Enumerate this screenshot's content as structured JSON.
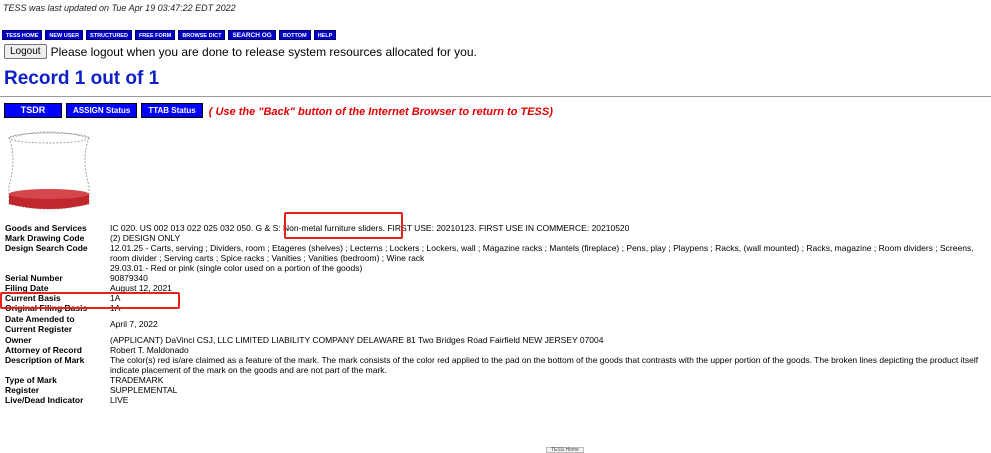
{
  "updated_text": "TESS was last updated on Tue Apr 19 03:47:22 EDT 2022",
  "nav": [
    {
      "label": "TESS Home"
    },
    {
      "label": "New User"
    },
    {
      "label": "Structured"
    },
    {
      "label": "Free Form"
    },
    {
      "label": "Browse Dict"
    },
    {
      "label": "SEARCH OG"
    },
    {
      "label": "Bottom"
    },
    {
      "label": "HELP"
    }
  ],
  "logout": {
    "button_label": "Logout",
    "message": "Please logout when you are done to release system resources allocated for you."
  },
  "record_title": "Record 1 out of 1",
  "status_buttons": {
    "tsdr": "TSDR",
    "assign": "ASSIGN Status",
    "ttab": "TTAB Status"
  },
  "back_message": "( Use the \"Back\" button of the Internet Browser to return to TESS)",
  "mark_image": {
    "icon": "design-mark-image",
    "fill_color": "#c0272d"
  },
  "fields": [
    {
      "label": "Goods and Services",
      "value": "IC 020. US 002 013 022 025 032 050. G & S: Non-metal furniture sliders. FIRST USE: 20210123. FIRST USE IN COMMERCE: 20210520"
    },
    {
      "label": "Mark Drawing Code",
      "value": "(2) DESIGN ONLY"
    },
    {
      "label": "Design Search Code",
      "value": "12.01.25 - Carts, serving ; Dividers, room ; Etageres (shelves) ; Lecterns ; Lockers ; Lockers, wall ; Magazine racks ; Mantels (fireplace) ; Pens, play ; Playpens ; Racks, (wall mounted) ; Racks, magazine ; Room dividers ; Screens, room divider ; Serving carts ; Spice racks ; Vanities ; Vanities (bedroom) ; Wine rack",
      "value2": "29.03.01 - Red or pink (single color used on a portion of the goods)"
    },
    {
      "label": "Serial Number",
      "value": "90879340"
    },
    {
      "label": "Filing Date",
      "value": "August 12, 2021"
    },
    {
      "label": "Current Basis",
      "value": "1A"
    },
    {
      "label": "Original Filing Basis",
      "value": "1A"
    },
    {
      "label": "Date Amended to Current Register",
      "value": "April 7, 2022"
    },
    {
      "label": "Owner",
      "value": "(APPLICANT) DaVinci CSJ, LLC LIMITED LIABILITY COMPANY DELAWARE 81 Two Bridges Road Fairfield NEW JERSEY 07004"
    },
    {
      "label": "Attorney of Record",
      "value": "Robert T. Maldonado"
    },
    {
      "label": "Description of Mark",
      "value": "The color(s) red is/are claimed as a feature of the mark. The mark consists of the color red applied to the pad on the bottom of the goods that contrasts with the upper portion of the goods. The broken lines depicting the product itself indicate placement of the mark on the goods and are not part of the mark."
    },
    {
      "label": "Type of Mark",
      "value": "TRADEMARK"
    },
    {
      "label": "Register",
      "value": "SUPPLEMENTAL"
    },
    {
      "label": "Live/Dead Indicator",
      "value": "LIVE"
    }
  ],
  "bottom_button": "TESS Home",
  "colors": {
    "nav_bg": "#0000cc",
    "title": "#1020c8",
    "back_msg": "#e00000",
    "highlight": "#e8201a"
  }
}
